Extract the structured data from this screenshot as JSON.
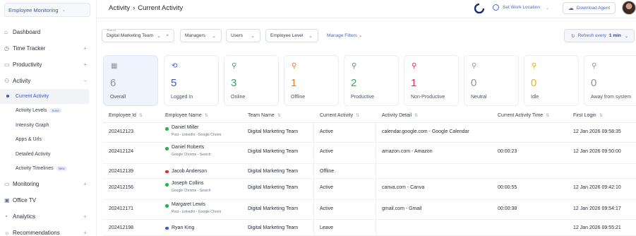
{
  "sidebar": {
    "org": "Employee Monitoring",
    "items": [
      {
        "label": "Dashboard",
        "icon": "home-icon",
        "expand": ""
      },
      {
        "label": "Time Tracker",
        "icon": "clock-icon",
        "expand": "+"
      },
      {
        "label": "Productivity",
        "icon": "briefcase-icon",
        "expand": "+"
      },
      {
        "label": "Activity",
        "icon": "activity-icon",
        "expand": "−"
      }
    ],
    "sub_items": [
      {
        "label": "Current Activity",
        "badge": ""
      },
      {
        "label": "Activity Levels",
        "badge": "Soon"
      },
      {
        "label": "Intensity Graph",
        "badge": ""
      },
      {
        "label": "Apps & Urls",
        "badge": ""
      },
      {
        "label": "Detailed Activity",
        "badge": ""
      },
      {
        "label": "Activity Timelines",
        "badge": "New"
      }
    ],
    "bottom_items": [
      {
        "label": "Monitoring",
        "icon": "monitor-icon",
        "expand": "+"
      },
      {
        "label": "Office TV",
        "icon": "tv-icon",
        "expand": ""
      },
      {
        "label": "Analytics",
        "icon": "chart-icon",
        "expand": "+"
      },
      {
        "label": "Recommendations",
        "icon": "bulb-icon",
        "expand": "+"
      }
    ]
  },
  "header": {
    "crumb1": "Activity",
    "crumb_sep": "›",
    "crumb2": "Current Activity",
    "set_work_location": "Set Work Location",
    "download_agent": "Download Agent"
  },
  "filters": {
    "teams_label": "Teams",
    "teams_value": "Digital Marketing Team",
    "managers": "Managers",
    "users": "Users",
    "employee_level": "Employee Level",
    "manage_filters": "Manage Filters",
    "refresh_label": "Refresh every",
    "refresh_value": "1 min"
  },
  "stats": [
    {
      "num": "6",
      "label": "Overall",
      "color": "#8b93a7"
    },
    {
      "num": "5",
      "label": "Logged In",
      "color": "#3f5bbf"
    },
    {
      "num": "3",
      "label": "Online",
      "color": "#2eae5a"
    },
    {
      "num": "1",
      "label": "Offline",
      "color": "#f07b2a"
    },
    {
      "num": "2",
      "label": "Productive",
      "color": "#2eae5a"
    },
    {
      "num": "1",
      "label": "Non-Productive",
      "color": "#e02d5a"
    },
    {
      "num": "0",
      "label": "Neutral",
      "color": "#8b93a7"
    },
    {
      "num": "0",
      "label": "Idle",
      "color": "#e6b422"
    },
    {
      "num": "0",
      "label": "Away from system",
      "color": "#8b93a7"
    }
  ],
  "table": {
    "columns": [
      "Employee Id",
      "Employee Name",
      "Team Name",
      "Current Activity",
      "Activity Detail",
      "Current Activity Time",
      "First Login"
    ],
    "rows": [
      {
        "id": "202412123",
        "name": "Daniel Miller",
        "sub": "Post - LinkedIn - Google Chrom",
        "team": "Digital Marketing Team",
        "activity": "Active",
        "detail": "calendar.google.com - Google Calendar",
        "time": "",
        "login": "12 Jan 2026 09:58:35",
        "dot": "#2eae5a"
      },
      {
        "id": "202412124",
        "name": "Daniel Roberts",
        "sub": "Google Chrome - Search",
        "team": "Digital Marketing Team",
        "activity": "Active",
        "detail": "amazon.com - Amazon",
        "time": "00:00:23",
        "login": "12 Jan 2026 09:50:00",
        "dot": "#2eae5a"
      },
      {
        "id": "202412139",
        "name": "Jacob Anderson",
        "sub": "",
        "team": "Digital Marketing Team",
        "activity": "Offline",
        "detail": "",
        "time": "",
        "login": "",
        "dot": "#e0282d"
      },
      {
        "id": "202412156",
        "name": "Joseph Collins",
        "sub": "Google Chrome - Search",
        "team": "Digital Marketing Team",
        "activity": "Active",
        "detail": "canva.com - Canva",
        "time": "00:00:55",
        "login": "12 Jan 2026 09:42:10",
        "dot": "#2eae5a"
      },
      {
        "id": "202412171",
        "name": "Margaret Lewis",
        "sub": "Post - LinkedIn - Google Chrom",
        "team": "Digital Marketing Team",
        "activity": "Active",
        "detail": "gmail.com - Gmail",
        "time": "00:00:38",
        "login": "12 Jan 2026 09:54:17",
        "dot": "#2eae5a"
      },
      {
        "id": "202412198",
        "name": "Ryan King",
        "sub": "",
        "team": "Digital Marketing Team",
        "activity": "Leave",
        "detail": "",
        "time": "",
        "login": "12 Jan 2026 09:55:21",
        "dot": "#3f5bbf"
      }
    ]
  }
}
